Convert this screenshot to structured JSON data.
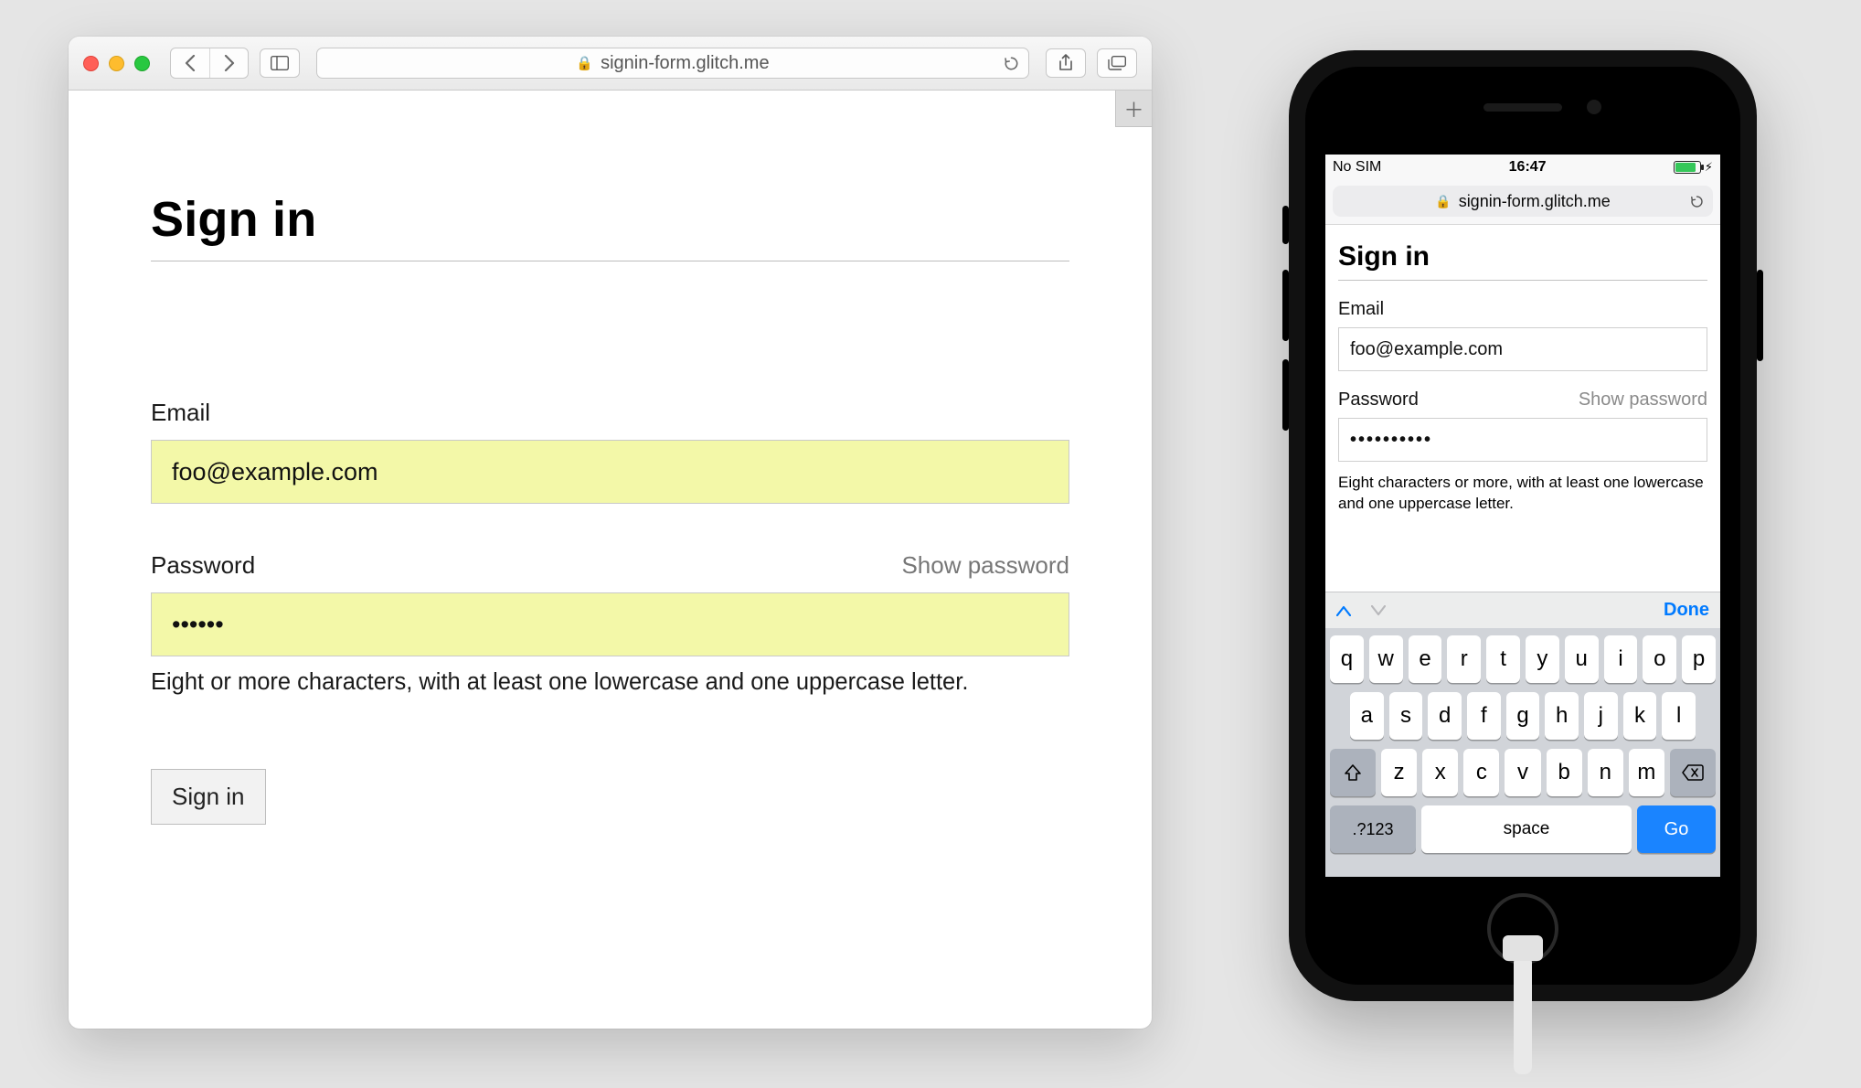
{
  "desktop": {
    "url": "signin-form.glitch.me",
    "page_title": "Sign in",
    "email": {
      "label": "Email",
      "value": "foo@example.com"
    },
    "password": {
      "label": "Password",
      "show_label": "Show password",
      "value": "••••••",
      "hint": "Eight or more characters, with at least one lowercase and one uppercase letter."
    },
    "submit_label": "Sign in"
  },
  "mobile": {
    "status": {
      "carrier": "No SIM",
      "time": "16:47"
    },
    "url": "signin-form.glitch.me",
    "page_title": "Sign in",
    "email": {
      "label": "Email",
      "value": "foo@example.com"
    },
    "password": {
      "label": "Password",
      "show_label": "Show password",
      "value": "••••••••••",
      "hint": "Eight characters or more, with at least one lowercase and one uppercase letter."
    },
    "kb_done": "Done",
    "keyboard": {
      "row1": [
        "q",
        "w",
        "e",
        "r",
        "t",
        "y",
        "u",
        "i",
        "o",
        "p"
      ],
      "row2": [
        "a",
        "s",
        "d",
        "f",
        "g",
        "h",
        "j",
        "k",
        "l"
      ],
      "row3": [
        "z",
        "x",
        "c",
        "v",
        "b",
        "n",
        "m"
      ],
      "numbers": ".?123",
      "space": "space",
      "go": "Go"
    }
  }
}
